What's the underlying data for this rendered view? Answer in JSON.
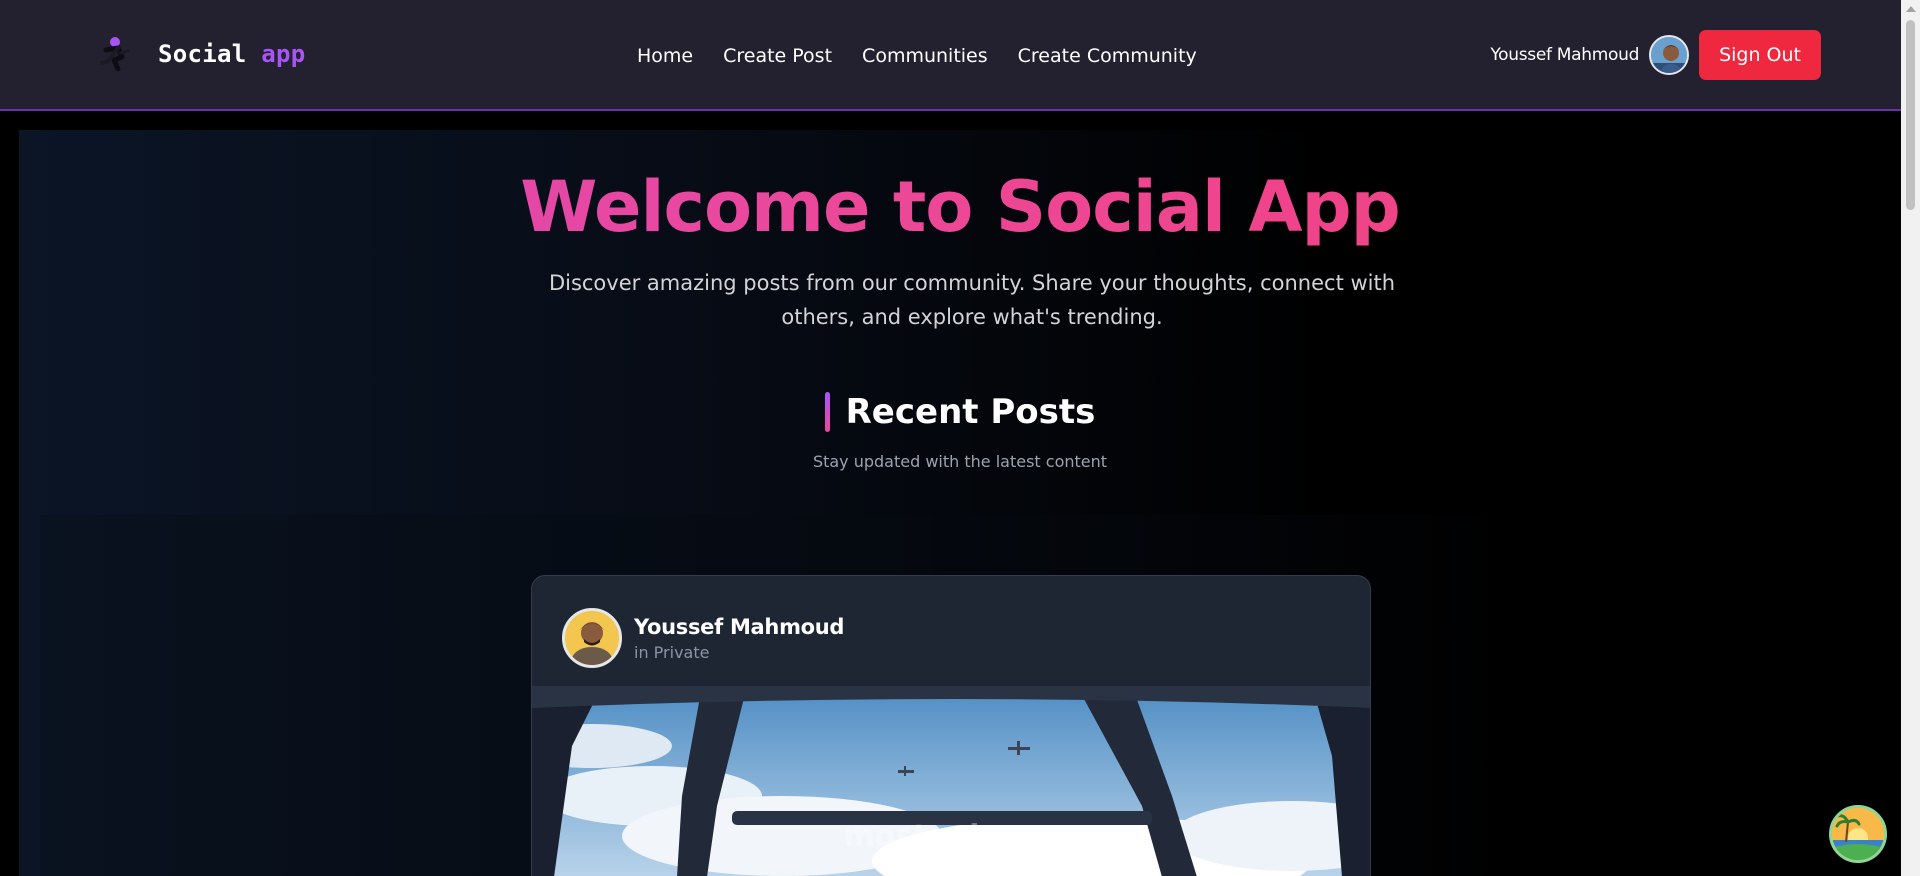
{
  "nav": {
    "brand_primary": "Social",
    "brand_accent": "app",
    "links": [
      "Home",
      "Create Post",
      "Communities",
      "Create Community"
    ],
    "user_name": "Youssef Mahmoud",
    "signout_label": "Sign Out"
  },
  "hero": {
    "title": "Welcome to Social App",
    "subtitle": "Discover amazing posts from our community. Share your thoughts, connect with others, and explore what's trending."
  },
  "section": {
    "title": "Recent Posts",
    "subtitle": "Stay updated with the latest content"
  },
  "post": {
    "author": "Youssef Mahmoud",
    "community": "in Private",
    "watermark": "mostaql.com"
  },
  "colors": {
    "accent_purple": "#a855f7",
    "accent_pink": "#ec4899",
    "signout_red": "#f0283f",
    "nav_bg": "#23212f",
    "card_bg": "#1e2533"
  },
  "icons": {
    "brand": "runner-logo-icon",
    "badge": "beach-sunset-icon"
  }
}
